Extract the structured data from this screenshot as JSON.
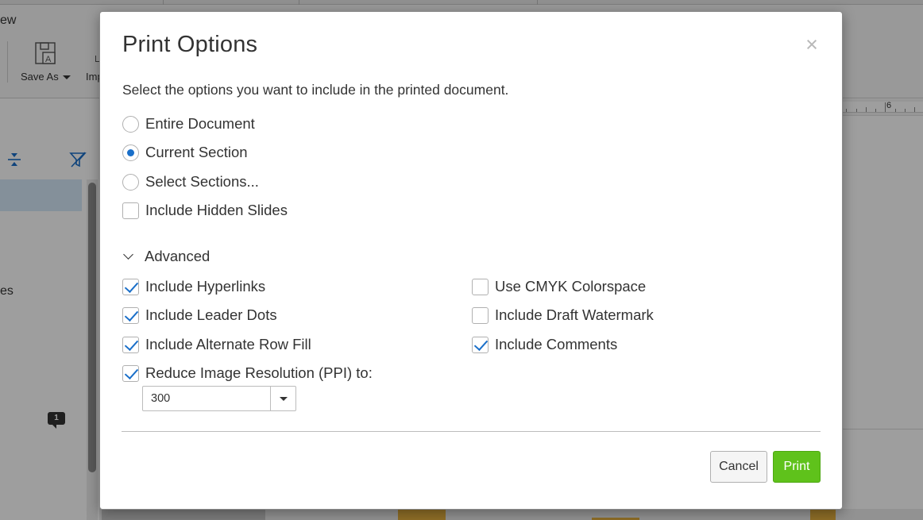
{
  "background_app": {
    "menu_fragment": "ew",
    "ribbon": {
      "save_as_label": "Save As",
      "import_fragment": "Imp"
    },
    "sidebar_fragment": "es",
    "comment_count": "1",
    "ruler_number": "6"
  },
  "dialog": {
    "title": "Print Options",
    "close_glyph": "×",
    "description": "Select the options you want to include in the printed document.",
    "scope_options": [
      {
        "label": "Entire Document",
        "selected": false
      },
      {
        "label": "Current Section",
        "selected": true
      },
      {
        "label": "Select Sections...",
        "selected": false
      }
    ],
    "include_hidden_slides": {
      "label": "Include Hidden Slides",
      "checked": false
    },
    "advanced": {
      "label": "Advanced",
      "expanded": true,
      "left_options": [
        {
          "label": "Include Hyperlinks",
          "checked": true
        },
        {
          "label": "Include Leader Dots",
          "checked": true
        },
        {
          "label": "Include Alternate Row Fill",
          "checked": true
        },
        {
          "label": "Reduce Image Resolution (PPI) to:",
          "checked": true
        }
      ],
      "right_options": [
        {
          "label": "Use CMYK Colorspace",
          "checked": false
        },
        {
          "label": "Include Draft Watermark",
          "checked": false
        },
        {
          "label": "Include Comments",
          "checked": true
        }
      ],
      "ppi_value": "300"
    },
    "buttons": {
      "cancel": "Cancel",
      "print": "Print"
    }
  },
  "colors": {
    "accent_blue": "#1a6fc9",
    "print_green": "#5fc21b"
  }
}
